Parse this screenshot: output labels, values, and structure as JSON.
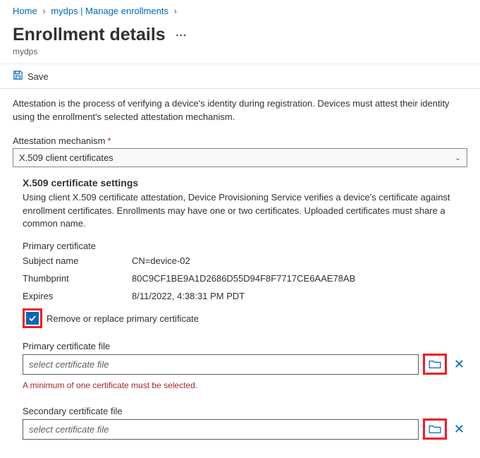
{
  "breadcrumb": {
    "home": "Home",
    "item2": "mydps | Manage enrollments"
  },
  "page": {
    "title": "Enrollment details",
    "ellipsis": "⋯",
    "subtitle": "mydps"
  },
  "cmdbar": {
    "save": "Save"
  },
  "attestation": {
    "description": "Attestation is the process of verifying a device's identity during registration. Devices must attest their identity using the enrollment's selected attestation mechanism.",
    "mechanism_label": "Attestation mechanism",
    "required": "*",
    "mechanism_value": "X.509 client certificates"
  },
  "x509": {
    "heading": "X.509 certificate settings",
    "description": "Using client X.509 certificate attestation, Device Provisioning Service verifies a device's certificate against enrollment certificates. Enrollments may have one or two certificates. Uploaded certificates must share a common name.",
    "primary_label": "Primary certificate",
    "subject_label": "Subject name",
    "subject_value": "CN=device-02",
    "thumb_label": "Thumbprint",
    "thumb_value": "80C9CF1BE9A1D2686D55D94F8F7717CE6AAE78AB",
    "expires_label": "Expires",
    "expires_value": "8/11/2022, 4:38:31 PM PDT",
    "remove_label": "Remove or replace primary certificate",
    "primary_file_label": "Primary certificate file",
    "file_placeholder": "select certificate file",
    "error": "A minimum of one certificate must be selected.",
    "secondary_file_label": "Secondary certificate file"
  }
}
